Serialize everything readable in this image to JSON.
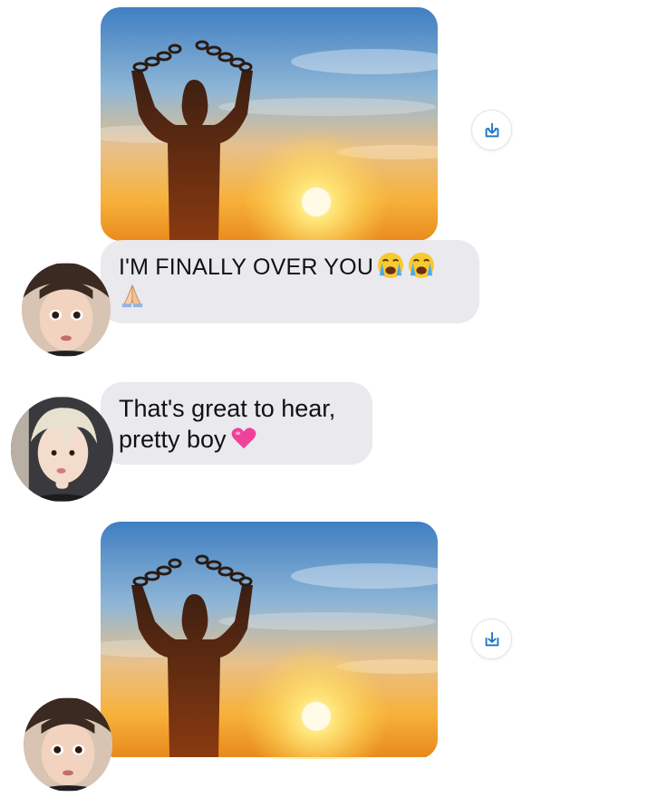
{
  "conversation": {
    "messages": [
      {
        "type": "image",
        "image_icon": "broken-chains-sunset-silhouette",
        "save_icon": "download-icon"
      },
      {
        "type": "text",
        "line1": "I'M FINALLY OVER YOU",
        "emojis": [
          "loudly-crying-face-emoji",
          "loudly-crying-face-emoji",
          "folded-hands-emoji"
        ]
      },
      {
        "type": "text",
        "line1": "That's great to hear,",
        "line2": "pretty boy",
        "emojis": [
          "pink-heart-emoji"
        ]
      },
      {
        "type": "image",
        "image_icon": "broken-chains-sunset-silhouette",
        "save_icon": "download-icon"
      }
    ]
  },
  "colors": {
    "bubble": "#e9e9ee",
    "accent": "#1a73c8",
    "sky_top": "#4a88c9",
    "sun": "#ffd34a"
  }
}
